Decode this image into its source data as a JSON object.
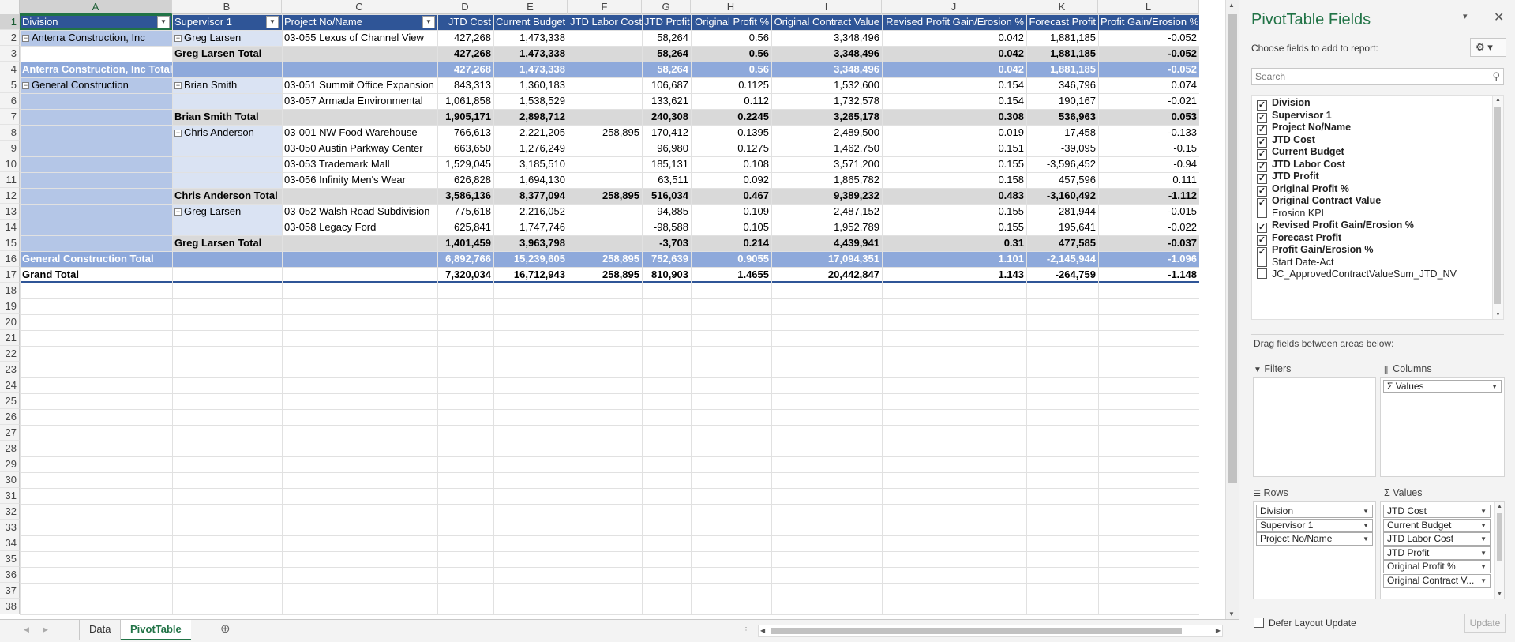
{
  "columns": [
    "A",
    "B",
    "C",
    "D",
    "E",
    "F",
    "G",
    "H",
    "I",
    "J",
    "K",
    "L"
  ],
  "headers": {
    "division": "Division",
    "supervisor": "Supervisor 1",
    "project": "Project No/Name",
    "jtd_cost": "JTD Cost",
    "current_budget": "Current Budget",
    "jtd_labor": "JTD Labor Cost",
    "jtd_profit": "JTD Profit",
    "orig_profit_pct": "Original Profit %",
    "orig_contract": "Original Contract Value",
    "revised_pge": "Revised Profit Gain/Erosion %",
    "forecast_profit": "Forecast Profit",
    "pge": "Profit Gain/Erosion %"
  },
  "row_numbers": [
    "1",
    "2",
    "3",
    "4",
    "5",
    "6",
    "7",
    "8",
    "9",
    "10",
    "11",
    "12",
    "13",
    "14",
    "15",
    "16",
    "17",
    "18",
    "19",
    "20",
    "21",
    "22",
    "23",
    "24",
    "25",
    "26",
    "27",
    "28",
    "29",
    "30",
    "31",
    "32",
    "33",
    "34",
    "35",
    "36",
    "37",
    "38"
  ],
  "rows": [
    {
      "type": "detail",
      "a": "Anterra Construction, Inc",
      "a_toggle": "−",
      "b": "Greg Larsen",
      "b_toggle": "−",
      "c": "03-055 Lexus of Channel View",
      "d": "427,268",
      "e": "1,473,338",
      "f": "",
      "g": "58,264",
      "h": "0.56",
      "i": "3,348,496",
      "j": "0.042",
      "k": "1,881,185",
      "l": "-0.052"
    },
    {
      "type": "subtotal",
      "b": "Greg Larsen Total",
      "d": "427,268",
      "e": "1,473,338",
      "f": "",
      "g": "58,264",
      "h": "0.56",
      "i": "3,348,496",
      "j": "0.042",
      "k": "1,881,185",
      "l": "-0.052"
    },
    {
      "type": "divtotal",
      "a": "Anterra Construction, Inc Total",
      "d": "427,268",
      "e": "1,473,338",
      "f": "",
      "g": "58,264",
      "h": "0.56",
      "i": "3,348,496",
      "j": "0.042",
      "k": "1,881,185",
      "l": "-0.052"
    },
    {
      "type": "detail",
      "a": "General Construction",
      "a_toggle": "−",
      "b": "Brian Smith",
      "b_toggle": "−",
      "c": "03-051 Summit Office Expansion",
      "d": "843,313",
      "e": "1,360,183",
      "f": "",
      "g": "106,687",
      "h": "0.1125",
      "i": "1,532,600",
      "j": "0.154",
      "k": "346,796",
      "l": "0.074"
    },
    {
      "type": "detail",
      "c": "03-057 Armada Environmental",
      "d": "1,061,858",
      "e": "1,538,529",
      "f": "",
      "g": "133,621",
      "h": "0.112",
      "i": "1,732,578",
      "j": "0.154",
      "k": "190,167",
      "l": "-0.021"
    },
    {
      "type": "subtotal",
      "b": "Brian Smith Total",
      "d": "1,905,171",
      "e": "2,898,712",
      "f": "",
      "g": "240,308",
      "h": "0.2245",
      "i": "3,265,178",
      "j": "0.308",
      "k": "536,963",
      "l": "0.053"
    },
    {
      "type": "detail",
      "b": "Chris Anderson",
      "b_toggle": "−",
      "c": "03-001 NW Food Warehouse",
      "d": "766,613",
      "e": "2,221,205",
      "f": "258,895",
      "g": "170,412",
      "h": "0.1395",
      "i": "2,489,500",
      "j": "0.019",
      "k": "17,458",
      "l": "-0.133"
    },
    {
      "type": "detail",
      "c": "03-050 Austin Parkway Center",
      "d": "663,650",
      "e": "1,276,249",
      "f": "",
      "g": "96,980",
      "h": "0.1275",
      "i": "1,462,750",
      "j": "0.151",
      "k": "-39,095",
      "l": "-0.15"
    },
    {
      "type": "detail",
      "c": "03-053 Trademark Mall",
      "d": "1,529,045",
      "e": "3,185,510",
      "f": "",
      "g": "185,131",
      "h": "0.108",
      "i": "3,571,200",
      "j": "0.155",
      "k": "-3,596,452",
      "l": "-0.94"
    },
    {
      "type": "detail",
      "c": "03-056 Infinity Men's Wear",
      "d": "626,828",
      "e": "1,694,130",
      "f": "",
      "g": "63,511",
      "h": "0.092",
      "i": "1,865,782",
      "j": "0.158",
      "k": "457,596",
      "l": "0.111"
    },
    {
      "type": "subtotal",
      "b": "Chris Anderson Total",
      "d": "3,586,136",
      "e": "8,377,094",
      "f": "258,895",
      "g": "516,034",
      "h": "0.467",
      "i": "9,389,232",
      "j": "0.483",
      "k": "-3,160,492",
      "l": "-1.112"
    },
    {
      "type": "detail",
      "b": "Greg Larsen",
      "b_toggle": "−",
      "c": "03-052 Walsh Road Subdivision",
      "d": "775,618",
      "e": "2,216,052",
      "f": "",
      "g": "94,885",
      "h": "0.109",
      "i": "2,487,152",
      "j": "0.155",
      "k": "281,944",
      "l": "-0.015"
    },
    {
      "type": "detail",
      "c": "03-058 Legacy Ford",
      "d": "625,841",
      "e": "1,747,746",
      "f": "",
      "g": "-98,588",
      "h": "0.105",
      "i": "1,952,789",
      "j": "0.155",
      "k": "195,641",
      "l": "-0.022"
    },
    {
      "type": "subtotal",
      "b": "Greg Larsen Total",
      "d": "1,401,459",
      "e": "3,963,798",
      "f": "",
      "g": "-3,703",
      "h": "0.214",
      "i": "4,439,941",
      "j": "0.31",
      "k": "477,585",
      "l": "-0.037"
    },
    {
      "type": "divtotal",
      "a": "General Construction Total",
      "d": "6,892,766",
      "e": "15,239,605",
      "f": "258,895",
      "g": "752,639",
      "h": "0.9055",
      "i": "17,094,351",
      "j": "1.101",
      "k": "-2,145,944",
      "l": "-1.096"
    },
    {
      "type": "grand",
      "a": "Grand Total",
      "d": "7,320,034",
      "e": "16,712,943",
      "f": "258,895",
      "g": "810,903",
      "h": "1.4655",
      "i": "20,442,847",
      "j": "1.143",
      "k": "-264,759",
      "l": "-1.148"
    }
  ],
  "sheet_tabs": {
    "data": "Data",
    "pivot": "PivotTable",
    "add": "⊕",
    "prev": "◀",
    "next": "▶"
  },
  "pane": {
    "title": "PivotTable Fields",
    "subtitle": "Choose fields to add to report:",
    "search_placeholder": "Search",
    "fields": [
      {
        "label": "Division",
        "checked": true
      },
      {
        "label": "Supervisor 1",
        "checked": true
      },
      {
        "label": "Project No/Name",
        "checked": true
      },
      {
        "label": "JTD Cost",
        "checked": true
      },
      {
        "label": "Current Budget",
        "checked": true
      },
      {
        "label": "JTD Labor Cost",
        "checked": true
      },
      {
        "label": "JTD Profit",
        "checked": true
      },
      {
        "label": "Original Profit %",
        "checked": true
      },
      {
        "label": "Original Contract Value",
        "checked": true
      },
      {
        "label": "Erosion KPI",
        "checked": false
      },
      {
        "label": "Revised Profit Gain/Erosion %",
        "checked": true
      },
      {
        "label": "Forecast Profit",
        "checked": true
      },
      {
        "label": "Profit Gain/Erosion %",
        "checked": true
      },
      {
        "label": "Start Date-Act",
        "checked": false
      },
      {
        "label": "JC_ApprovedContractValueSum_JTD_NV",
        "checked": false
      }
    ],
    "drag_hint": "Drag fields between areas below:",
    "filters_label": "Filters",
    "columns_label": "Columns",
    "rows_label": "Rows",
    "values_label": "Values",
    "columns_chip": "Σ Values",
    "rows_chips": [
      "Division",
      "Supervisor 1",
      "Project No/Name"
    ],
    "values_chips": [
      "JTD Cost",
      "Current Budget",
      "JTD Labor Cost",
      "JTD Profit",
      "Original Profit %",
      "Original Contract V..."
    ],
    "defer_label": "Defer Layout Update",
    "update_label": "Update"
  },
  "colors": {
    "header_blue": "#2f5597",
    "divtotal_blue": "#8ea9db",
    "row_blue": "#b4c6e7",
    "light_blue": "#dae3f3",
    "subtotal_gray": "#d9d9d9",
    "excel_green": "#217346"
  }
}
